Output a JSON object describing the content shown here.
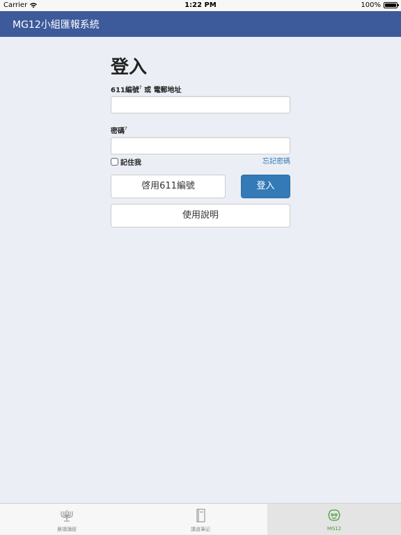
{
  "status_bar": {
    "carrier": "Carrier",
    "time": "1:22 PM",
    "battery": "100%"
  },
  "nav": {
    "title": "MG12小組匯報系統"
  },
  "login": {
    "heading": "登入",
    "id_label": "611編號",
    "id_help": "?",
    "id_or": "或",
    "id_label_2": "電郵地址",
    "id_value": "",
    "password_label": "密碼",
    "password_help": "?",
    "password_value": "",
    "remember_label": "記住我",
    "forgot_label": "忘記密碼",
    "activate_label": "啓用611編號",
    "login_label": "登入",
    "help_label": "使用說明"
  },
  "tabs": [
    {
      "label": "晨禱讀經",
      "icon": "menorah-icon",
      "active": false
    },
    {
      "label": "講道筆記",
      "icon": "notebook-icon",
      "active": false
    },
    {
      "label": "MG12",
      "icon": "mg12-logo-icon",
      "active": true
    }
  ],
  "colors": {
    "nav_bg": "#3d5a9b",
    "primary": "#337ab7",
    "link": "#337ab7",
    "active_tab": "#4a9e3a",
    "page_bg": "#ebeef4"
  }
}
